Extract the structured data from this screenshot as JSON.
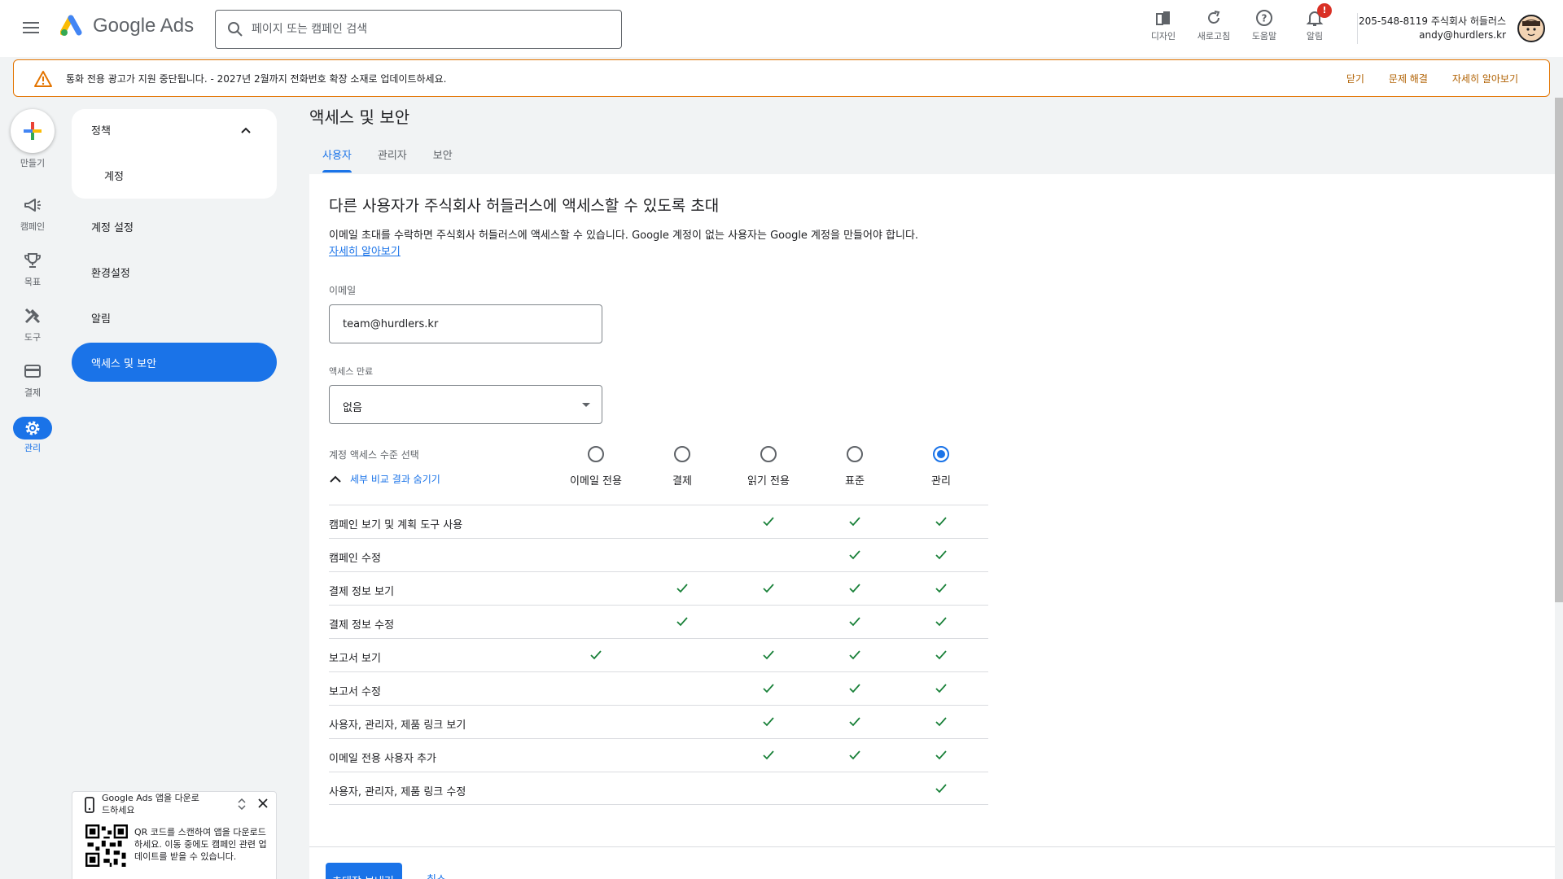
{
  "header": {
    "brand": "Google Ads",
    "search_placeholder": "페이지 또는 캠페인 검색",
    "icons": [
      {
        "label": "디자인",
        "icon": "appearance-icon"
      },
      {
        "label": "새로고침",
        "icon": "refresh-icon"
      },
      {
        "label": "도움말",
        "icon": "help-icon"
      },
      {
        "label": "알림",
        "icon": "bell-icon"
      }
    ],
    "notification_badge": "!",
    "account_name": "205-548-8119 주식회사 허들러스",
    "account_email": "andy@hurdlers.kr"
  },
  "banner": {
    "message": "통화 전용 광고가 지원 중단됩니다. - 2027년 2월까지 전화번호 확장 소재로 업데이트하세요.",
    "actions": [
      "닫기",
      "문제 해결",
      "자세히 알아보기"
    ]
  },
  "rail": {
    "create": "만들기",
    "items": [
      "캠페인",
      "목표",
      "도구",
      "결제",
      "관리"
    ]
  },
  "subnav": {
    "section_title": "정책",
    "section_items": [
      "계정"
    ],
    "items": [
      "계정 설정",
      "환경설정",
      "알림"
    ],
    "active": "액세스 및 보안"
  },
  "promo": {
    "title": "Google Ads 앱을 다운로드하세요",
    "body": "QR 코드를 스캔하여 앱을 다운로드하세요. 이동 중에도 캠페인 관련 업데이트를 받을 수 있습니다."
  },
  "page": {
    "title": "액세스 및 보안",
    "tabs": [
      "사용자",
      "관리자",
      "보안"
    ],
    "active_tab": 0
  },
  "form": {
    "heading": "다른 사용자가 주식회사 허들러스에 액세스할 수 있도록 초대",
    "description": "이메일 초대를 수락하면 주식회사 허들러스에 액세스할 수 있습니다. Google 계정이 없는 사용자는 Google 계정을 만들어야 합니다.",
    "learn_more": "자세히 알아보기",
    "email_label": "이메일",
    "email_value": "team@hurdlers.kr",
    "expire_label": "액세스 만료",
    "expire_value": "없음",
    "level_label": "계정 액세스 수준 선택",
    "toggle_details": "세부 비교 결과 숨기기",
    "levels": [
      "이메일 전용",
      "결제",
      "읽기 전용",
      "표준",
      "관리"
    ],
    "selected_level": 4,
    "permissions": [
      {
        "name": "캠페인 보기 및 계획 도구 사용",
        "checks": [
          false,
          false,
          true,
          true,
          true
        ]
      },
      {
        "name": "캠페인 수정",
        "checks": [
          false,
          false,
          false,
          true,
          true
        ]
      },
      {
        "name": "결제 정보 보기",
        "checks": [
          false,
          true,
          true,
          true,
          true
        ]
      },
      {
        "name": "결제 정보 수정",
        "checks": [
          false,
          true,
          false,
          true,
          true
        ]
      },
      {
        "name": "보고서 보기",
        "checks": [
          true,
          false,
          true,
          true,
          true
        ]
      },
      {
        "name": "보고서 수정",
        "checks": [
          false,
          false,
          true,
          true,
          true
        ]
      },
      {
        "name": "사용자, 관리자, 제품 링크 보기",
        "checks": [
          false,
          false,
          true,
          true,
          true
        ]
      },
      {
        "name": "이메일 전용 사용자 추가",
        "checks": [
          false,
          false,
          true,
          true,
          true
        ]
      },
      {
        "name": "사용자, 관리자, 제품 링크 수정",
        "checks": [
          false,
          false,
          false,
          false,
          true
        ]
      }
    ],
    "send_label": "초대장 보내기",
    "cancel_label": "취소"
  },
  "colors": {
    "accent": "#1a73e8",
    "check": "#188038",
    "warning": "#e37400"
  }
}
